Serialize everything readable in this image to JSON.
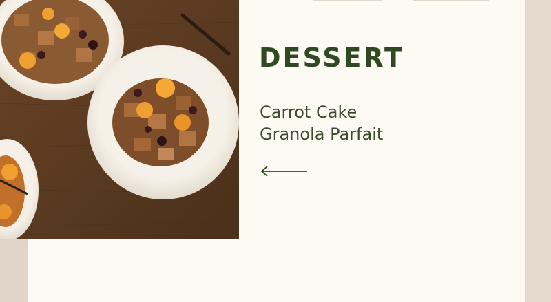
{
  "card": {
    "photo_alt": "Carrot cake granola parfait in white bowls",
    "category": "DESSERT",
    "title_line1": "Carrot Cake",
    "title_line2": "Granola Parfait",
    "back_icon": "arrow-left-icon"
  },
  "colors": {
    "accent": "#2f4a22",
    "panel": "#fdf9f3",
    "side": "#e3d9cd"
  }
}
